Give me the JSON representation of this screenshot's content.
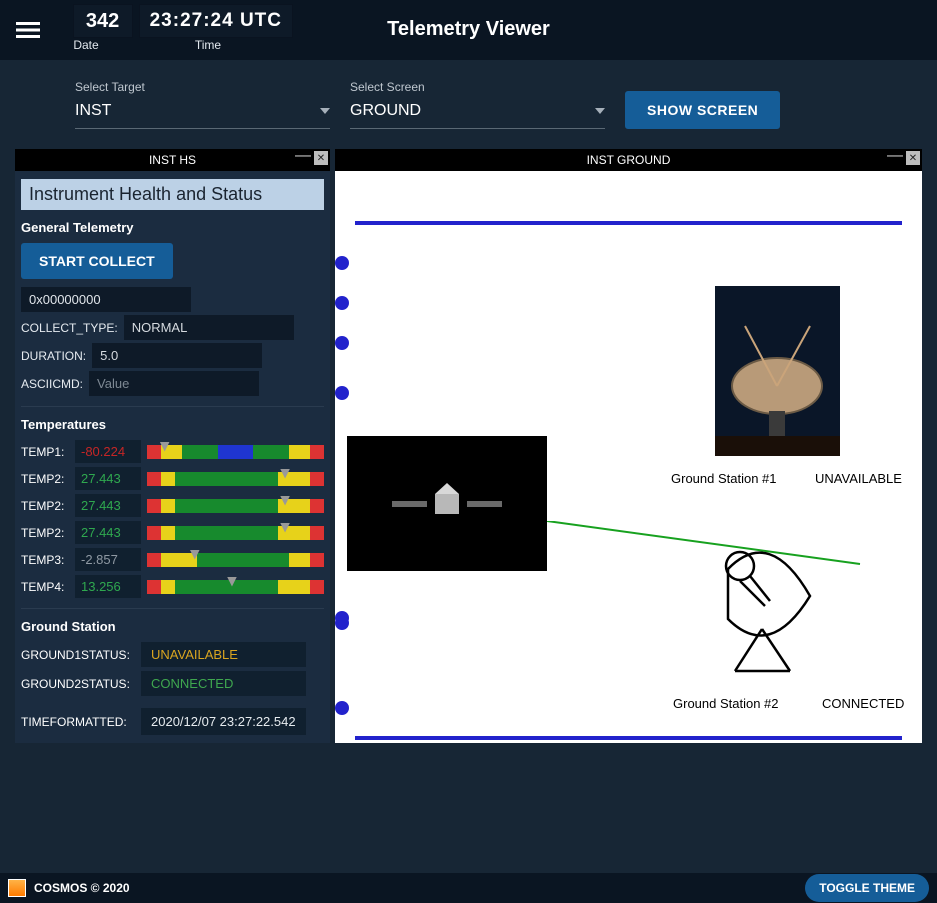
{
  "app_title": "Telemetry Viewer",
  "clock": {
    "date_num": "342",
    "time": "23:27:24  UTC",
    "date_lbl": "Date",
    "time_lbl": "Time"
  },
  "controls": {
    "target_label": "Select Target",
    "target_value": "INST",
    "screen_label": "Select Screen",
    "screen_value": "GROUND",
    "show_btn": "SHOW SCREEN"
  },
  "hs": {
    "title": "INST HS",
    "header": "Instrument Health and Status",
    "general": "General Telemetry",
    "start_btn": "START COLLECT",
    "addr": "0x00000000",
    "collect_type_lbl": "COLLECT_TYPE:",
    "collect_type_val": "NORMAL",
    "duration_lbl": "DURATION:",
    "duration_val": "5.0",
    "ascii_lbl": "ASCIICMD:",
    "ascii_val": "Value",
    "temps_title": "Temperatures",
    "temps": [
      {
        "label": "TEMP1:",
        "value": "-80.224",
        "cls": "red-txt",
        "ptr": 10
      },
      {
        "label": "TEMP2:",
        "value": "27.443",
        "cls": "grn-txt",
        "ptr": 78
      },
      {
        "label": "TEMP2:",
        "value": "27.443",
        "cls": "grn-txt",
        "ptr": 78
      },
      {
        "label": "TEMP2:",
        "value": "27.443",
        "cls": "grn-txt",
        "ptr": 78
      },
      {
        "label": "TEMP3:",
        "value": "-2.857",
        "cls": "gry-txt",
        "ptr": 27
      },
      {
        "label": "TEMP4:",
        "value": "13.256",
        "cls": "grn-txt",
        "ptr": 48
      }
    ],
    "gs_title": "Ground Station",
    "gs1_lbl": "GROUND1STATUS:",
    "gs1_val": "UNAVAILABLE",
    "gs2_lbl": "GROUND2STATUS:",
    "gs2_val": "CONNECTED",
    "time_lbl": "TIMEFORMATTED:",
    "time_val": "2020/12/07 23:27:22.542"
  },
  "ground": {
    "title": "INST GROUND",
    "gs1_name": "Ground Station #1",
    "gs1_status": "UNAVAILABLE",
    "gs2_name": "Ground Station #2",
    "gs2_status": "CONNECTED"
  },
  "footer": {
    "brand": "COSMOS © 2020",
    "toggle": "TOGGLE THEME"
  }
}
